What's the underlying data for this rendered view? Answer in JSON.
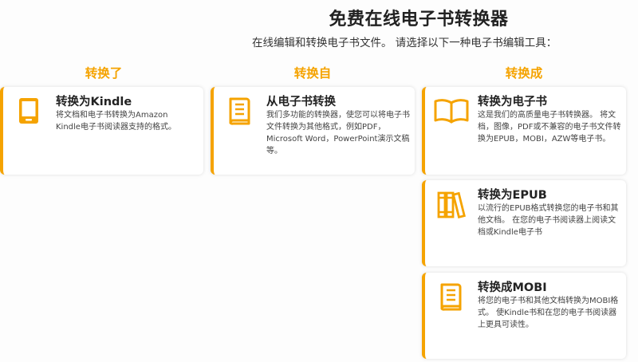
{
  "header": {
    "title": "免费在线电子书转换器",
    "subtitle": "在线编辑和转换电子书文件。 请选择以下一种电子书编辑工具："
  },
  "columns": [
    {
      "heading": "转换了"
    },
    {
      "heading": "转换自"
    },
    {
      "heading": "转换成"
    }
  ],
  "cards": {
    "kindle": {
      "icon": "kindle-device-icon",
      "title": "转换为Kindle",
      "desc": "将文档和电子书转换为Amazon Kindle电子书阅读器支持的格式。"
    },
    "from_ebook": {
      "icon": "book-icon",
      "title": "从电子书转换",
      "desc": "我们多功能的转换器，使您可以将电子书文件转换为其他格式，例如PDF，Microsoft Word，PowerPoint演示文稿等。"
    },
    "to_ebook": {
      "icon": "open-book-icon",
      "title": "转换为电子书",
      "desc": "这是我们的高质量电子书转换器。 将文档，图像，PDF或不兼容的电子书文件转换为EPUB，MOBI，AZW等电子书。"
    },
    "epub": {
      "icon": "books-on-shelf-icon",
      "title": "转换为EPUB",
      "desc": "以流行的EPUB格式转换您的电子书和其他文档。 在您的电子书阅读器上阅读文档或Kindle电子书"
    },
    "mobi": {
      "icon": "book-icon",
      "title": "转换成MOBI",
      "desc": "将您的电子书和其他文档转换为MOBI格式。 使Kindle书和在您的电子书阅读器上更具可读性。"
    }
  },
  "colors": {
    "accent": "#f5a300",
    "title": "#222222",
    "text": "#444444"
  }
}
